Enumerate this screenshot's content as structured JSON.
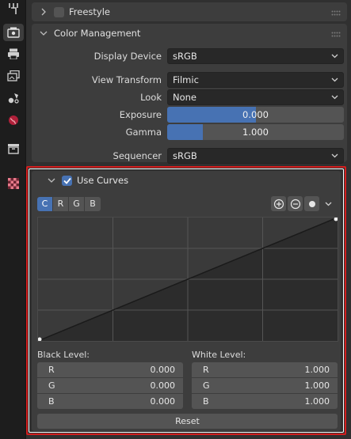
{
  "freestyle": {
    "label": "Freestyle",
    "enabled": false
  },
  "color_management": {
    "title": "Color Management",
    "display_device": {
      "label": "Display Device",
      "value": "sRGB"
    },
    "view_transform": {
      "label": "View Transform",
      "value": "Filmic"
    },
    "look": {
      "label": "Look",
      "value": "None"
    },
    "exposure": {
      "label": "Exposure",
      "value": "0.000",
      "fill": 0.5
    },
    "gamma": {
      "label": "Gamma",
      "value": "1.000",
      "fill": 0.2
    },
    "sequencer": {
      "label": "Sequencer",
      "value": "sRGB"
    }
  },
  "curves": {
    "title": "Use Curves",
    "enabled": true,
    "channels": [
      "C",
      "R",
      "G",
      "B"
    ],
    "active_channel": "C",
    "black_level": {
      "title": "Black Level:",
      "rows": [
        {
          "k": "R",
          "v": "0.000"
        },
        {
          "k": "G",
          "v": "0.000"
        },
        {
          "k": "B",
          "v": "0.000"
        }
      ]
    },
    "white_level": {
      "title": "White Level:",
      "rows": [
        {
          "k": "R",
          "v": "1.000"
        },
        {
          "k": "G",
          "v": "1.000"
        },
        {
          "k": "B",
          "v": "1.000"
        }
      ]
    },
    "reset_label": "Reset"
  },
  "tabs": [
    "tool-icon",
    "render-icon",
    "output-icon",
    "view-layer-icon",
    "scene-icon",
    "world-icon",
    "collection-icon",
    "texture-icon"
  ],
  "colors": {
    "accent": "#4772b3",
    "highlight": "#d41e1e"
  }
}
